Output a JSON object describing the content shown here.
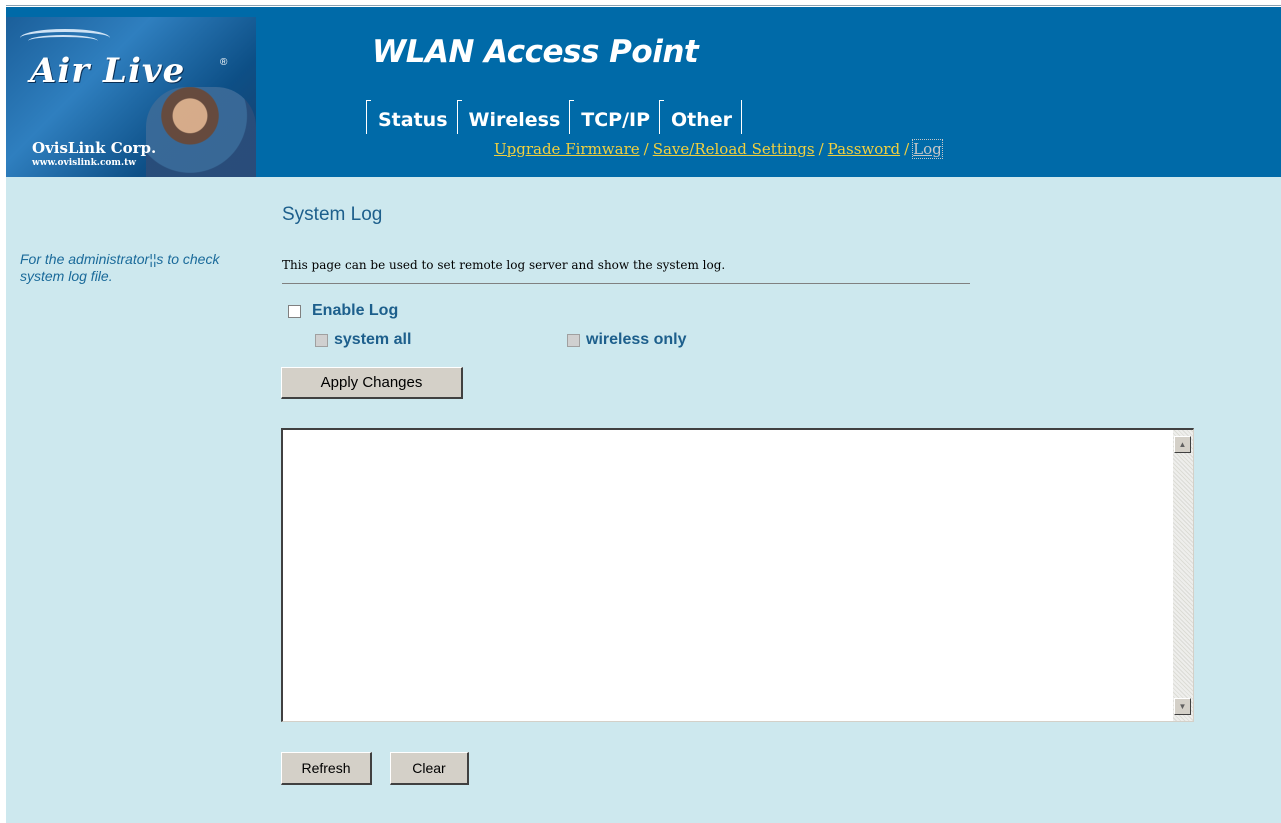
{
  "brand": {
    "name": "Air Live",
    "registered_mark": "®",
    "company": "OvisLink Corp.",
    "url_text": "www.ovislink.com.tw"
  },
  "header": {
    "title": "WLAN Access Point",
    "tabs": [
      {
        "label": "Status"
      },
      {
        "label": "Wireless"
      },
      {
        "label": "TCP/IP"
      },
      {
        "label": "Other"
      }
    ],
    "subnav": [
      {
        "label": "Upgrade Firmware"
      },
      {
        "label": "Save/Reload Settings"
      },
      {
        "label": "Password"
      },
      {
        "label": "Log"
      }
    ],
    "separator": "/"
  },
  "sidebar": {
    "help_text": "For the administrator¦¦s to check system log file."
  },
  "main": {
    "title": "System Log",
    "description": "This page can be used to set remote log server and show the system log.",
    "enable_log": {
      "label": "Enable Log",
      "checked": false
    },
    "options": [
      {
        "label": "system all",
        "checked": false,
        "disabled": true
      },
      {
        "label": "wireless only",
        "checked": false,
        "disabled": true
      }
    ],
    "apply_button": "Apply Changes",
    "log_content": "",
    "refresh_button": "Refresh",
    "clear_button": "Clear"
  },
  "colors": {
    "header_bg": "#006aa8",
    "content_bg": "#cde8ee",
    "label_blue": "#1d5f8c",
    "link_yellow": "#f0d040"
  }
}
